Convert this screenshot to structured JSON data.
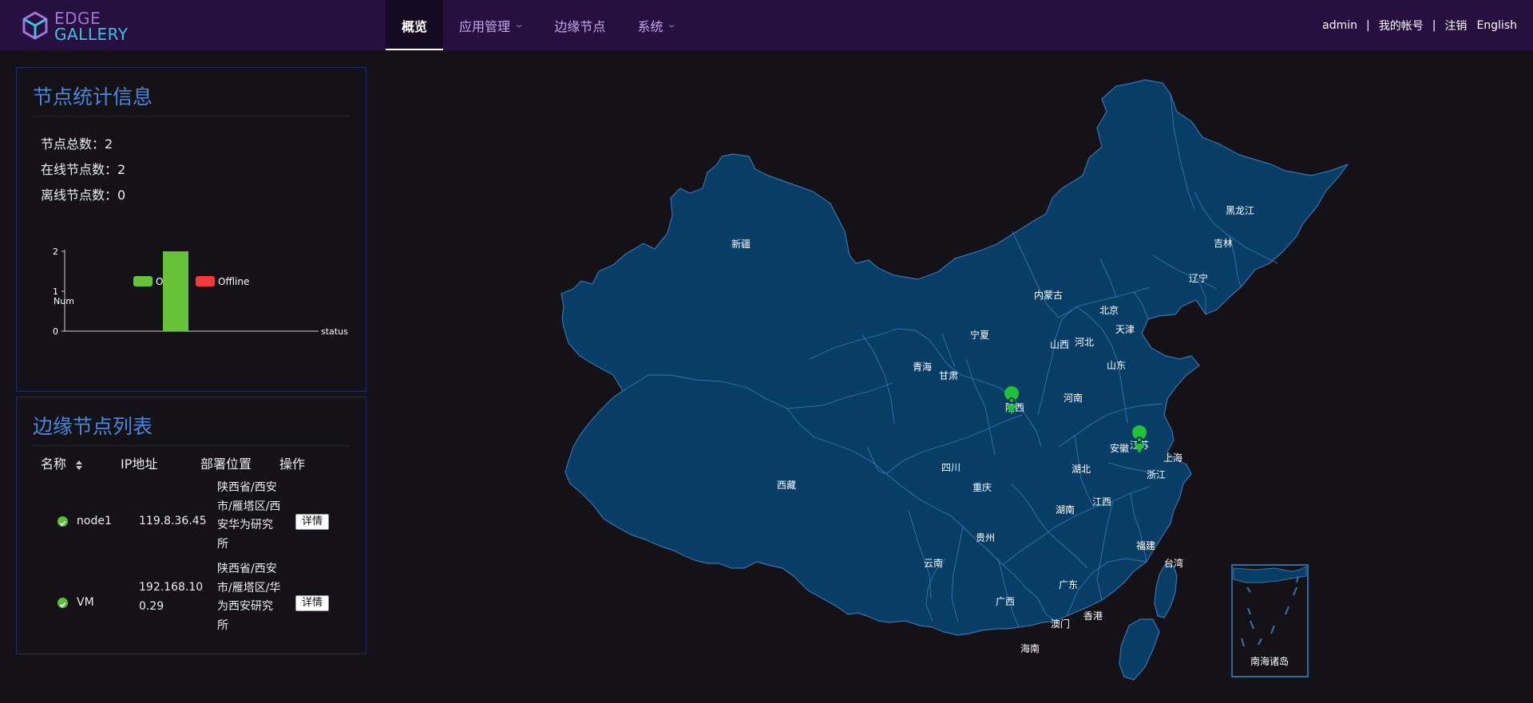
{
  "header": {
    "logo_line1": "EDGE",
    "logo_line2": "GALLERY",
    "nav": [
      {
        "label": "概览",
        "active": true
      },
      {
        "label": "应用管理",
        "dropdown": true
      },
      {
        "label": "边缘节点"
      },
      {
        "label": "系统",
        "dropdown": true
      }
    ],
    "user": "admin",
    "separator": "|",
    "account": "我的帐号",
    "logout": "注销",
    "language": "English"
  },
  "stats_panel": {
    "title": "节点统计信息",
    "total_label": "节点总数：2",
    "online_label": "在线节点数：2",
    "offline_label": "离线节点数：0"
  },
  "chart_data": {
    "type": "bar",
    "ylabel": "Num",
    "xlabel": "status",
    "categories": [
      "status"
    ],
    "series": [
      {
        "name": "Online",
        "values": [
          2
        ],
        "color": "#67c23a"
      },
      {
        "name": "Offline",
        "values": [
          0
        ],
        "color": "#f23c3c"
      }
    ],
    "ylim": [
      0,
      2
    ],
    "yticks": [
      "0",
      "1",
      "2"
    ],
    "legend": "top",
    "grid": false
  },
  "nodes_panel": {
    "title": "边缘节点列表",
    "columns": {
      "name": "名称",
      "ip": "IP地址",
      "location": "部署位置",
      "action": "操作"
    },
    "rows": [
      {
        "status": "online",
        "name": "node1",
        "ip": "119.8.36.45",
        "location_lines": [
          "陕西省/西安",
          "市/雁塔区/西",
          "安华为研究",
          "所"
        ],
        "action": "详情"
      },
      {
        "status": "online",
        "name": "VM",
        "ip_lines": [
          "192.168.10",
          "0.29"
        ],
        "location_lines": [
          "陕西省/西安",
          "市/雁塔区/华",
          "为西安研究",
          "所"
        ],
        "action": "详情"
      }
    ]
  },
  "map": {
    "fill": "#083d66",
    "border": "#3a72b0",
    "marker_color": "#21c23a",
    "provinces": [
      "新疆",
      "西藏",
      "青海",
      "甘肃",
      "宁夏",
      "内蒙古",
      "北京",
      "天津",
      "河北",
      "山西",
      "山东",
      "河南",
      "陕西",
      "四川",
      "重庆",
      "湖北",
      "安徽",
      "江苏",
      "上海",
      "浙江",
      "江西",
      "湖南",
      "贵州",
      "云南",
      "广西",
      "广东",
      "福建",
      "台湾",
      "香港",
      "澳门",
      "海南",
      "黑龙江",
      "吉林",
      "辽宁"
    ],
    "inset_label": "南海诸岛"
  },
  "icons": {
    "logo": "cube-logo-icon",
    "status": "online-check-icon",
    "sort": "sort-arrows-icon",
    "marker": "map-pin-icon"
  }
}
